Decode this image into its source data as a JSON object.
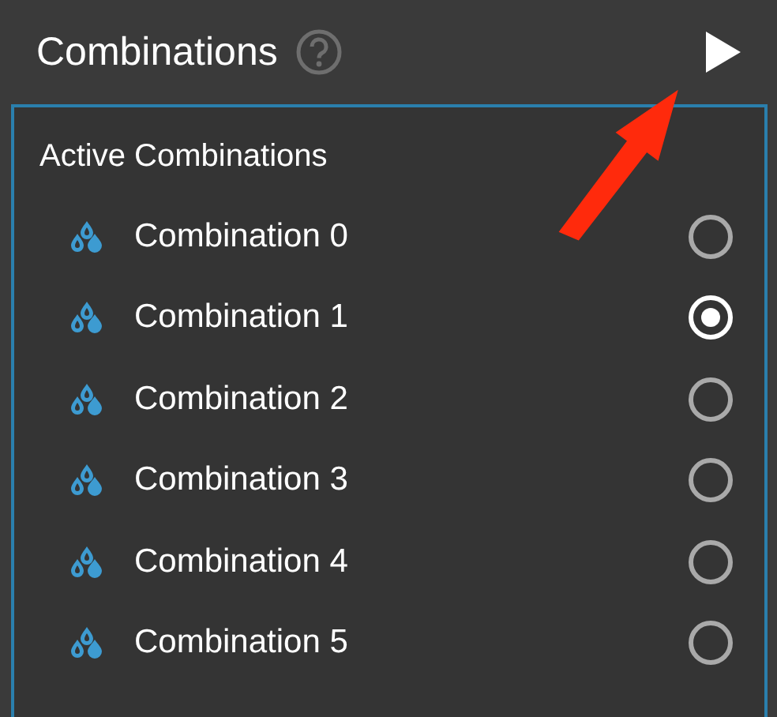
{
  "header": {
    "title": "Combinations"
  },
  "panel": {
    "title": "Active Combinations",
    "items": [
      {
        "label": "Combination 0",
        "selected": false
      },
      {
        "label": "Combination 1",
        "selected": true
      },
      {
        "label": "Combination 2",
        "selected": false
      },
      {
        "label": "Combination 3",
        "selected": false
      },
      {
        "label": "Combination 4",
        "selected": false
      },
      {
        "label": "Combination 5",
        "selected": false
      }
    ]
  }
}
